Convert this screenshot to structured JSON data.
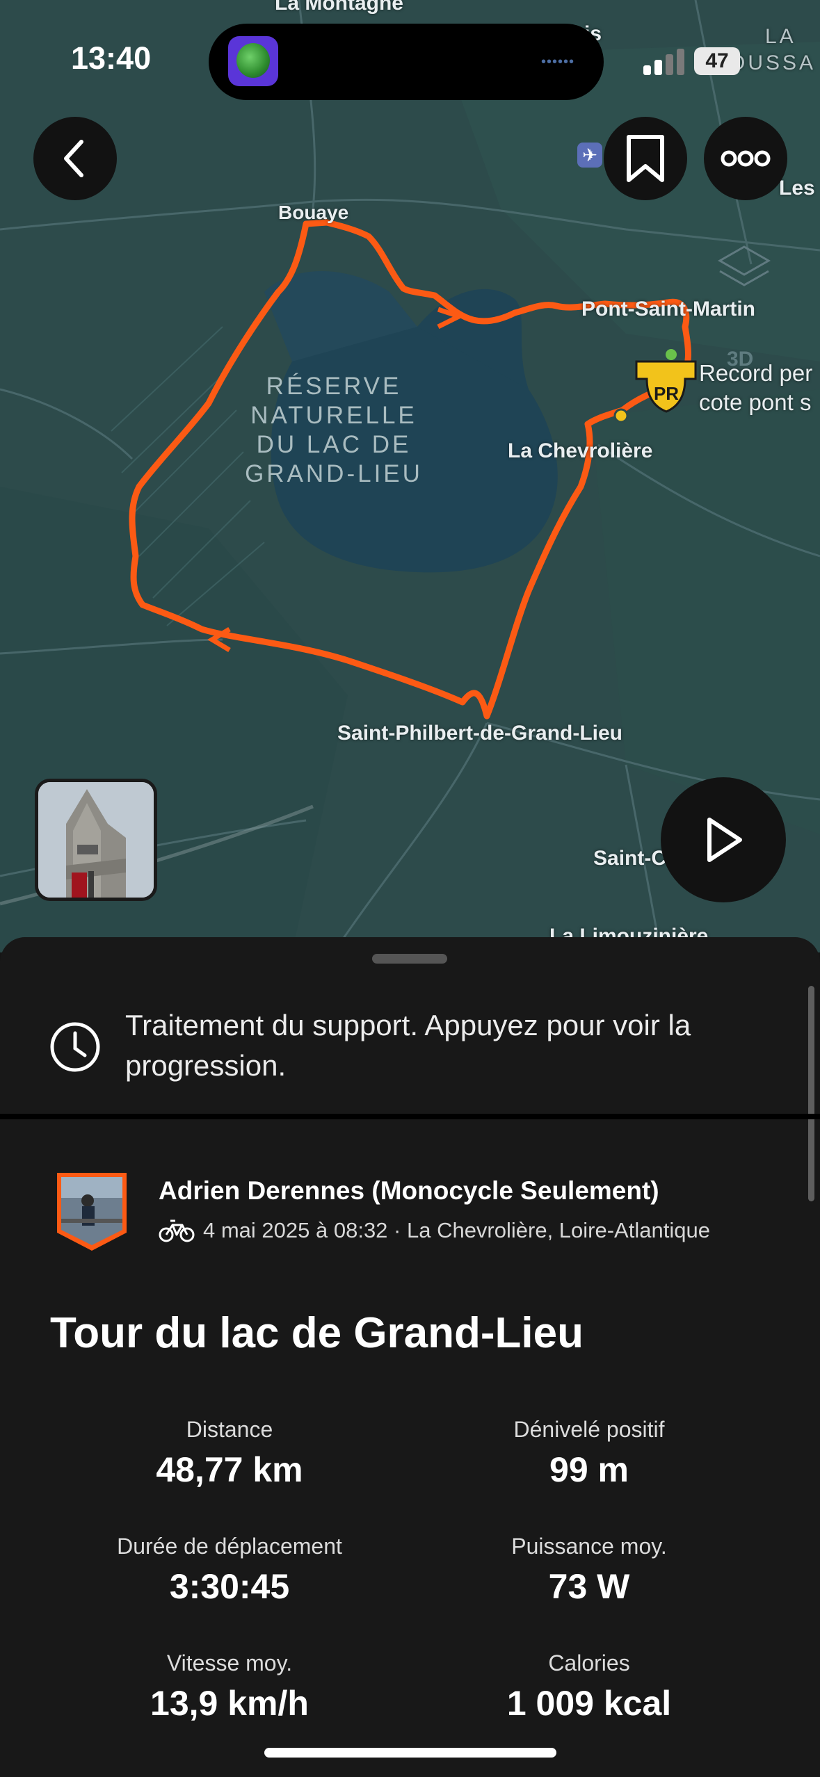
{
  "status_bar": {
    "time": "13:40",
    "battery": "47"
  },
  "map": {
    "labels": {
      "la_montagne": "La Montagne",
      "bouaye": "Bouaye",
      "pont_saint_martin": "Pont-Saint-Martin",
      "la_chevroliere": "La Chevrolière",
      "saint_philbert": "Saint-Philbert-de-Grand-Lieu",
      "saint_c": "Saint-C",
      "la_limouziniere": "La Limouzinière",
      "les": "Les",
      "la_roussay_top": "LA",
      "la_roussay_bottom": "OUSSA",
      "is": "is",
      "segment_record_line1": "Record per",
      "segment_record_line2": "cote pont s",
      "pr_badge": "PR",
      "three_d": "3D"
    },
    "reserve_label": [
      "RÉSERVE",
      "NATURELLE",
      "DU LAC DE",
      "GRAND-LIEU"
    ],
    "route_color": "#fc5a14"
  },
  "buttons": {
    "back_icon": "chevron-left-icon",
    "bookmark_icon": "bookmark-icon",
    "more_icon": "ellipsis-icon",
    "play_icon": "play-icon"
  },
  "sheet": {
    "processing_notice": "Traitement du support. Appuyez pour voir la progression.",
    "athlete_name": "Adrien Derennes (Monocycle Seulement)",
    "activity_meta": "4 mai 2025 à 08:32 · La Chevrolière, Loire-Atlantique",
    "activity_title": "Tour du lac de Grand-Lieu",
    "stats": [
      {
        "label": "Distance",
        "value": "48,77 km"
      },
      {
        "label": "Dénivelé positif",
        "value": "99 m"
      },
      {
        "label": "Durée de déplacement",
        "value": "3:30:45"
      },
      {
        "label": "Puissance moy.",
        "value": "73 W"
      },
      {
        "label": "Vitesse moy.",
        "value": "13,9 km/h"
      },
      {
        "label": "Calories",
        "value": "1 009 kcal"
      }
    ]
  }
}
